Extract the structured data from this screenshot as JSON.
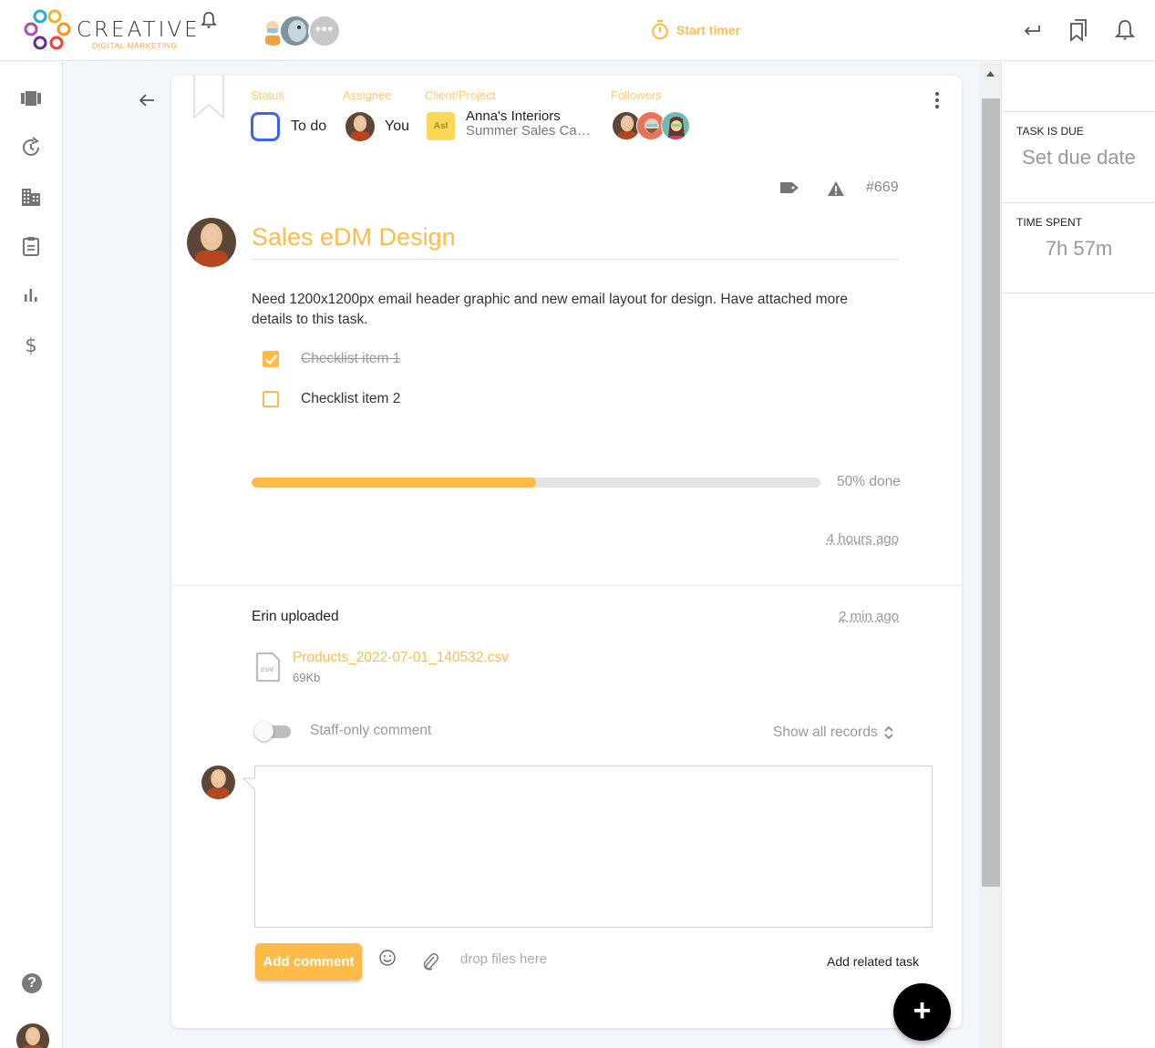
{
  "brand": {
    "name": "CREATIVE",
    "tagline": "DIGITAL MARKETING"
  },
  "topbar": {
    "timer_label": "Start timer",
    "more_avatars_label": "•••",
    "icons": [
      "bell-icon",
      "return-icon",
      "bookmarks-icon",
      "notifications-icon"
    ]
  },
  "leftnav": {
    "items": [
      {
        "name": "boards",
        "icon": "view-carousel-icon"
      },
      {
        "name": "history",
        "icon": "history-icon"
      },
      {
        "name": "clients",
        "icon": "building-icon"
      },
      {
        "name": "tasks",
        "icon": "clipboard-icon"
      },
      {
        "name": "reports",
        "icon": "bar-chart-icon"
      },
      {
        "name": "billing",
        "icon": "dollar-icon"
      }
    ],
    "help_label": "?"
  },
  "task": {
    "meta": {
      "status_label": "Status",
      "status_value": "To do",
      "assignee_label": "Assignee",
      "assignee_value": "You",
      "client_label": "Client/Project",
      "client_initials": "AsI",
      "client_name": "Anna's Interiors",
      "project_name": "Summer Sales Campaign",
      "followers_label": "Followers"
    },
    "id": "#669",
    "title": "Sales eDM Design",
    "description": "Need 1200x1200px email header graphic and new email layout for design. Have attached more details to this task.",
    "checklist": [
      {
        "label": "Checklist item 1",
        "done": true
      },
      {
        "label": "Checklist item 2",
        "done": false
      }
    ],
    "progress_percent": 50,
    "progress_text": "50% done",
    "created_ago": "4 hours ago"
  },
  "activity": {
    "who": "Erin uploaded",
    "ago": "2 min ago",
    "file_name": "Products_2022-07-01_140532.csv",
    "file_size": "69Kb",
    "file_type": "csv"
  },
  "comment": {
    "staff_only_label": "Staff-only comment",
    "staff_only_on": false,
    "show_records_label": "Show all records",
    "placeholder": "",
    "add_comment_label": "Add comment",
    "drop_files_label": "drop files here",
    "related_task_label": "Add related task"
  },
  "fab_label": "+",
  "rightpanel": {
    "due_label": "TASK IS DUE",
    "due_value": "Set due date",
    "time_label": "TIME SPENT",
    "time_value": "7h 57m"
  },
  "colors": {
    "accent": "#fdbb4a",
    "status_blue": "#3d63f2",
    "client_badge": "#fcd857"
  }
}
